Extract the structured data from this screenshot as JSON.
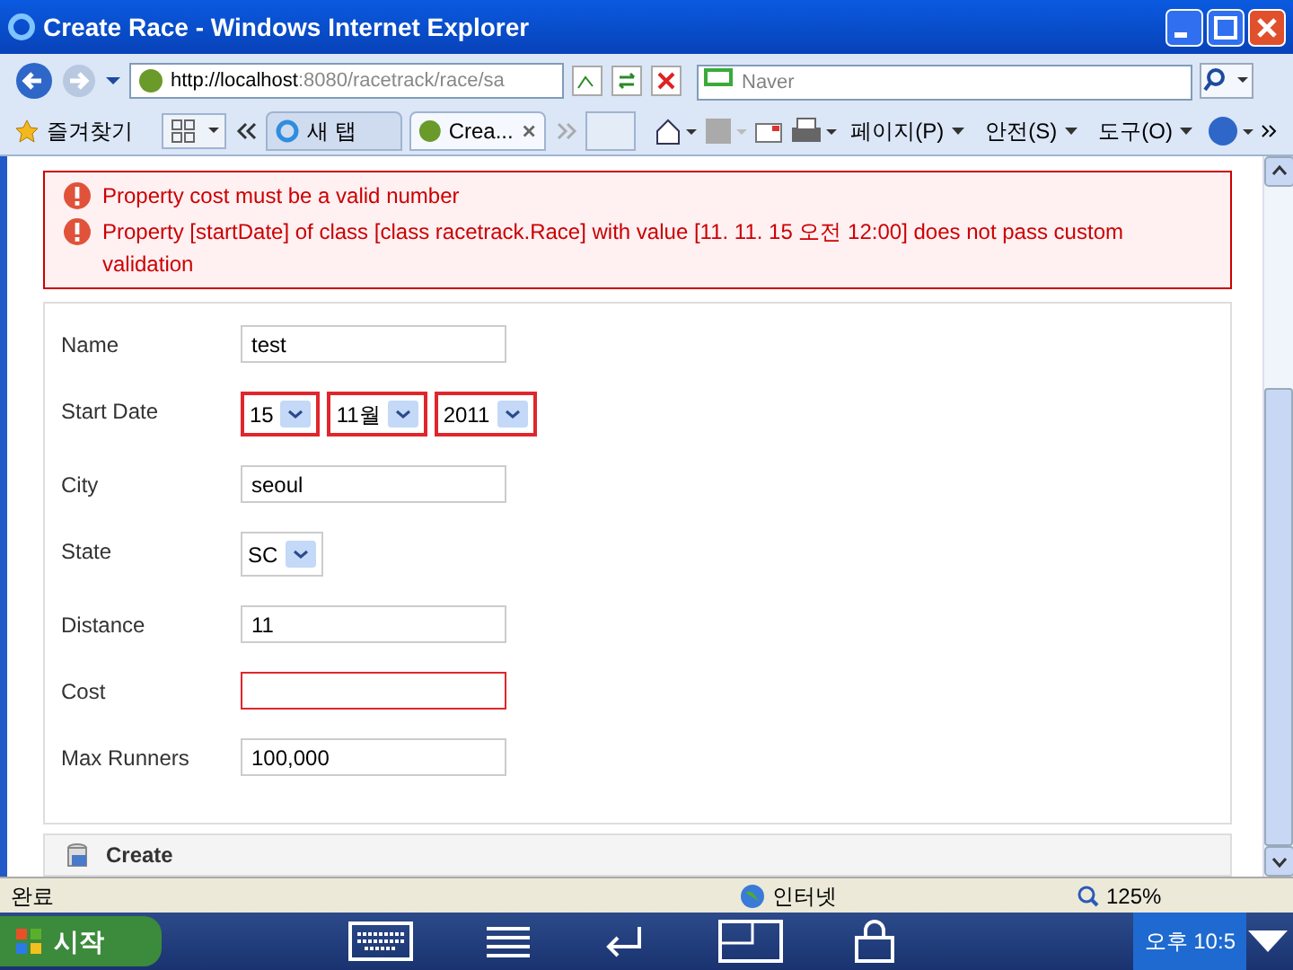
{
  "window": {
    "title": "Create Race - Windows Internet Explorer"
  },
  "address_bar": {
    "url_host": "http://localhost",
    "url_rest": ":8080/racetrack/race/sa",
    "search_placeholder": "Naver"
  },
  "favorites": {
    "label": "즐겨찾기"
  },
  "tabs": [
    {
      "label": "새 탭",
      "selected": false
    },
    {
      "label": "Crea...",
      "selected": true
    }
  ],
  "command_bar": [
    "페이지(P)",
    "안전(S)",
    "도구(O)"
  ],
  "errors": [
    "Property cost must be a valid number",
    "Property [startDate] of class [class racetrack.Race] with value [11. 11. 15 오전 12:00] does not pass custom validation"
  ],
  "fields": [
    {
      "label": "Name",
      "kind": "text",
      "value": "test",
      "error": false
    },
    {
      "label": "Start Date",
      "kind": "date",
      "parts": [
        "15",
        "11월",
        "2011"
      ],
      "error": true
    },
    {
      "label": "City",
      "kind": "text",
      "value": "seoul",
      "error": false
    },
    {
      "label": "State",
      "kind": "select",
      "value": "SC",
      "error": false
    },
    {
      "label": "Distance",
      "kind": "text",
      "value": "11",
      "error": false
    },
    {
      "label": "Cost",
      "kind": "text",
      "error": true
    },
    {
      "label": "Max Runners",
      "kind": "text",
      "value": "100,000",
      "error": false
    }
  ],
  "create_button": {
    "label": "Create"
  },
  "status_bar": {
    "status": "완료",
    "zone": "인터넷",
    "zoom": "125%"
  },
  "taskbar": {
    "start": "시작",
    "clock": "오후 10:5"
  }
}
